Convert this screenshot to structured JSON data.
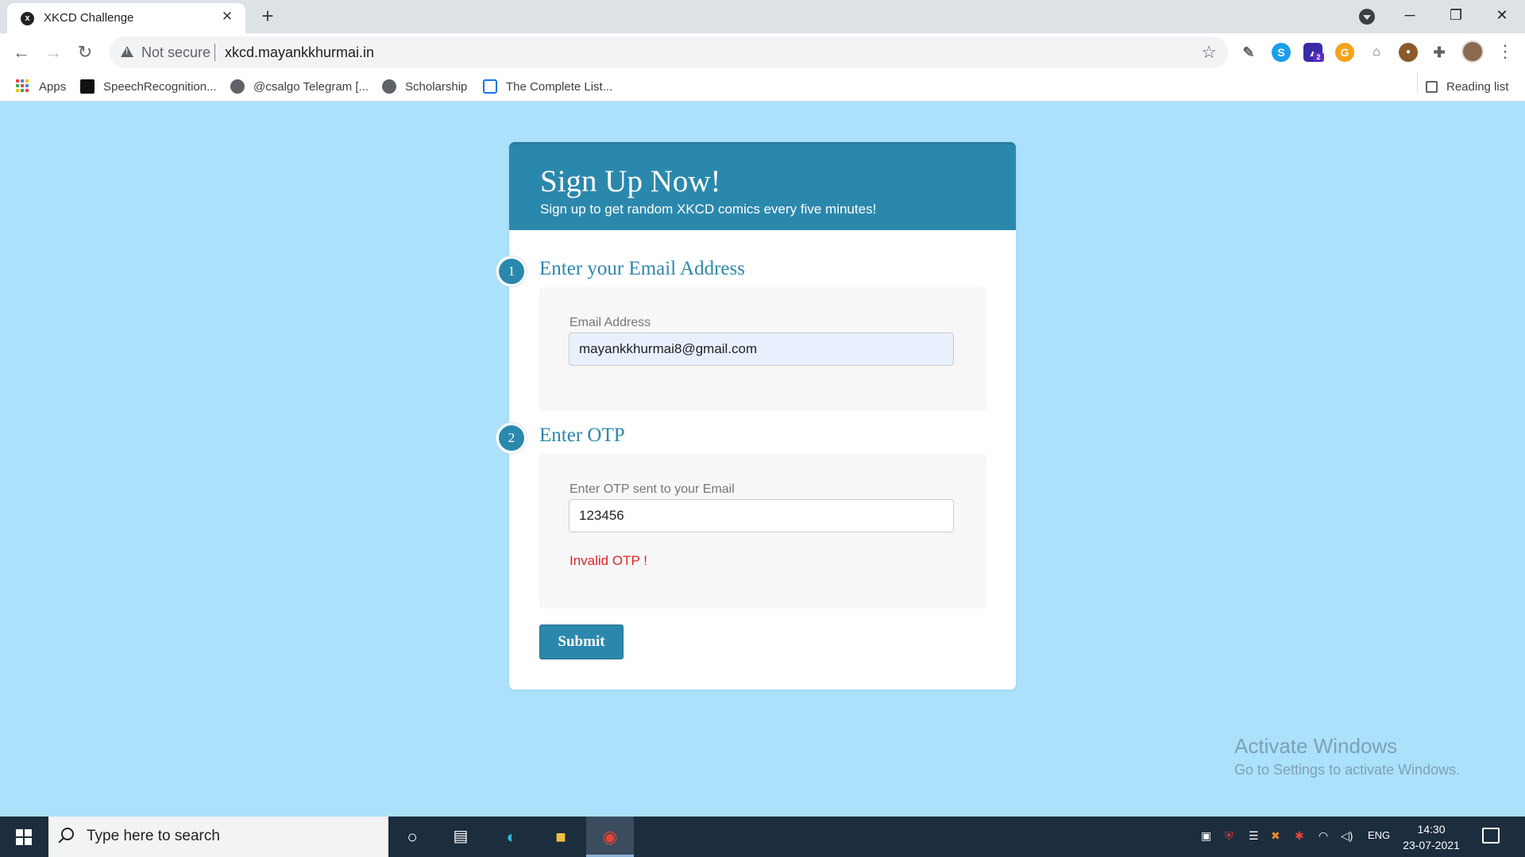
{
  "browser": {
    "tab_title": "XKCD Challenge",
    "tab_favicon_letter": "x",
    "new_tab_symbol": "+",
    "close_symbol": "✕",
    "security_label": "Not secure",
    "url": "xkcd.mayankkhurmai.in",
    "window_controls": {
      "minimize": "─",
      "maximize": "❐",
      "close": "✕"
    }
  },
  "bookmarks": {
    "items": [
      {
        "label": "Apps",
        "icon": "apps-grid-icon"
      },
      {
        "label": "SpeechRecognition...",
        "icon": "bookmark-favicon-icon"
      },
      {
        "label": "@csalgo Telegram [...",
        "icon": "globe-icon"
      },
      {
        "label": "Scholarship",
        "icon": "globe-icon"
      },
      {
        "label": "The Complete List...",
        "icon": "lock-favicon-icon"
      }
    ],
    "reading_list": "Reading list"
  },
  "extensions": {
    "badge_count": "2",
    "colors": {
      "skype": "#1a9ee8",
      "mortarboard": "#3a2ca8",
      "grammarly": "#f5a21c",
      "cookie": "#8b5a2b"
    }
  },
  "signup": {
    "title": "Sign Up Now!",
    "subtitle": "Sign up to get random XKCD comics every five minutes!",
    "step1": {
      "number": "1",
      "heading": "Enter your Email Address",
      "field_label": "Email Address",
      "field_value": "mayankkhurmai8@gmail.com"
    },
    "step2": {
      "number": "2",
      "heading": "Enter OTP",
      "field_label": "Enter OTP sent to your Email",
      "field_value": "123456",
      "error": "Invalid OTP !"
    },
    "submit_label": "Submit",
    "accent_color": "#2b88ad",
    "background_color": "#abe1fa",
    "error_color": "#e02424"
  },
  "watermark": {
    "line1": "Activate Windows",
    "line2": "Go to Settings to activate Windows."
  },
  "taskbar": {
    "search_placeholder": "Type here to search",
    "language": "ENG",
    "time": "14:30",
    "date": "23-07-2021"
  }
}
